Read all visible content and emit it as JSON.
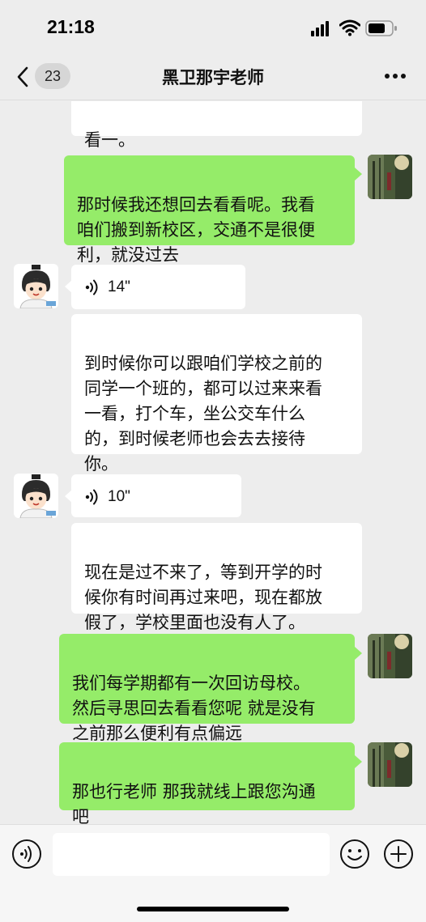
{
  "status_bar": {
    "time": "21:18"
  },
  "header": {
    "unread_count": "23",
    "title": "黑卫那宇老师"
  },
  "messages": [
    {
      "side": "left",
      "kind": "text",
      "text": "看一。"
    },
    {
      "side": "right",
      "kind": "text",
      "text": "那时候我还想回去看看呢。我看\n咱们搬到新校区，交通不是很便\n利，就没过去"
    },
    {
      "side": "left",
      "kind": "voice",
      "duration": "14\""
    },
    {
      "side": "left",
      "kind": "text",
      "text": "到时候你可以跟咱们学校之前的\n同学一个班的，都可以过来来看\n一看，打个车，坐公交车什么\n的，到时候老师也会去去接待\n你。"
    },
    {
      "side": "left",
      "kind": "voice",
      "duration": "10\""
    },
    {
      "side": "left",
      "kind": "text",
      "text": "现在是过不来了，等到开学的时\n候你有时间再过来吧，现在都放\n假了，学校里面也没有人了。"
    },
    {
      "side": "right",
      "kind": "text",
      "text": "我们每学期都有一次回访母校。\n然后寻思回去看看您呢 就是没有\n之前那么便利有点偏远"
    },
    {
      "side": "right",
      "kind": "text",
      "text": "那也行老师 那我就线上跟您沟通\n吧"
    }
  ],
  "colors": {
    "background": "#ededed",
    "sent_bubble": "#95ec69",
    "received_bubble": "#ffffff"
  },
  "icons": [
    "signal-icon",
    "wifi-icon",
    "battery-icon",
    "back-chevron-icon",
    "more-icon",
    "voice-wave-icon",
    "voice-input-icon",
    "emoji-icon",
    "plus-icon"
  ]
}
